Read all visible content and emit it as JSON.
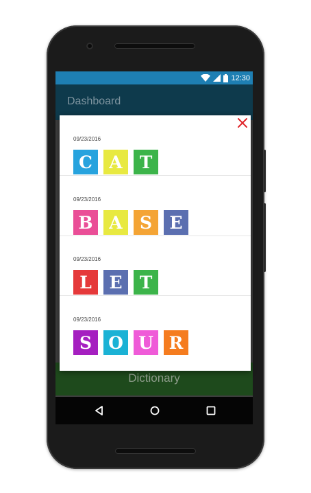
{
  "status": {
    "time": "12:30"
  },
  "appbar": {
    "title": "Dashboard"
  },
  "dictionary": {
    "label": "Dictionary"
  },
  "icons": {
    "close": "close-icon",
    "back": "back-triangle-icon",
    "home": "home-circle-icon",
    "recents": "recents-square-icon",
    "wifi": "wifi-icon",
    "signal": "signal-icon",
    "battery": "battery-icon"
  },
  "colors": {
    "status_bar": "#1e7fb3",
    "app_bar": "#0e3a4c",
    "close": "#e0262b"
  },
  "history": [
    {
      "date": "09/23/2016",
      "tiles": [
        {
          "letter": "C",
          "color": "#27a3de"
        },
        {
          "letter": "A",
          "color": "#e8e941"
        },
        {
          "letter": "T",
          "color": "#3cb44a"
        }
      ]
    },
    {
      "date": "09/23/2016",
      "tiles": [
        {
          "letter": "B",
          "color": "#ea4e97"
        },
        {
          "letter": "A",
          "color": "#e8e941"
        },
        {
          "letter": "S",
          "color": "#f4a435"
        },
        {
          "letter": "E",
          "color": "#5b6fb0"
        }
      ]
    },
    {
      "date": "09/23/2016",
      "tiles": [
        {
          "letter": "L",
          "color": "#e5393a"
        },
        {
          "letter": "E",
          "color": "#5b6fb0"
        },
        {
          "letter": "T",
          "color": "#3cb44a"
        }
      ]
    },
    {
      "date": "09/23/2016",
      "tiles": [
        {
          "letter": "S",
          "color": "#a51fc0"
        },
        {
          "letter": "O",
          "color": "#1bb2d5"
        },
        {
          "letter": "U",
          "color": "#ef5bd8"
        },
        {
          "letter": "R",
          "color": "#f57c1f"
        }
      ]
    }
  ]
}
